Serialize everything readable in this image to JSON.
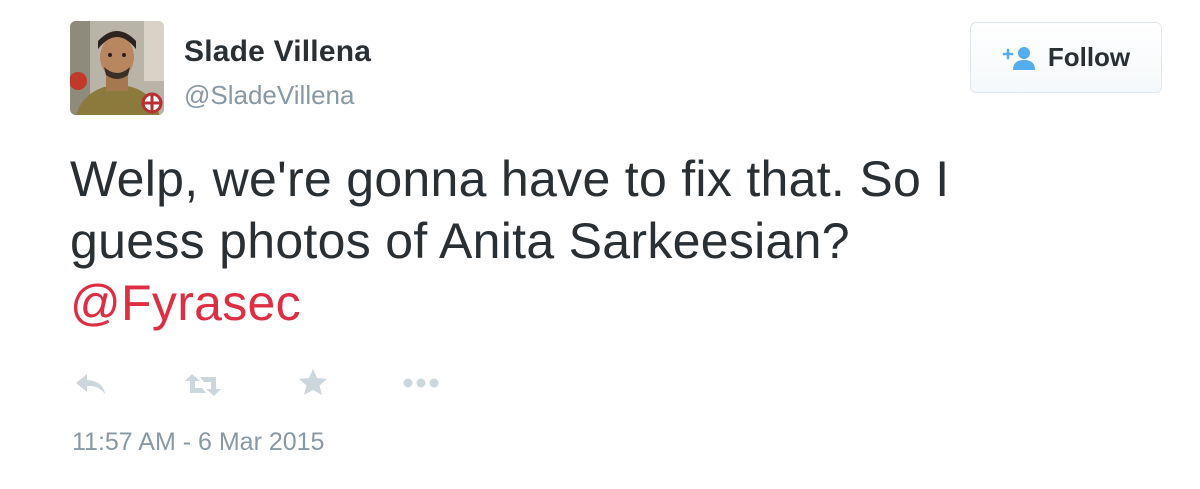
{
  "user": {
    "name": "Slade Villena",
    "handle": "@SladeVillena",
    "avatar_icon": "user-photo-avatar"
  },
  "follow_button": {
    "label": "Follow",
    "icon": "add-user-icon"
  },
  "tweet": {
    "text_line1": "Welp, we're gonna have to fix that. So I",
    "text_line2": "guess photos of Anita Sarkeesian?",
    "mention": "@Fyrasec",
    "timestamp": "11:57 AM - 6 Mar 2015"
  },
  "actions": [
    {
      "name": "reply",
      "icon": "reply-icon"
    },
    {
      "name": "retweet",
      "icon": "retweet-icon"
    },
    {
      "name": "favorite",
      "icon": "star-icon"
    },
    {
      "name": "more",
      "icon": "more-dots-icon"
    }
  ],
  "colors": {
    "text": "#292f33",
    "muted": "#8899a6",
    "mention": "#dd2e44",
    "action_icon": "#ccd6dd",
    "follow_icon": "#55acee"
  }
}
